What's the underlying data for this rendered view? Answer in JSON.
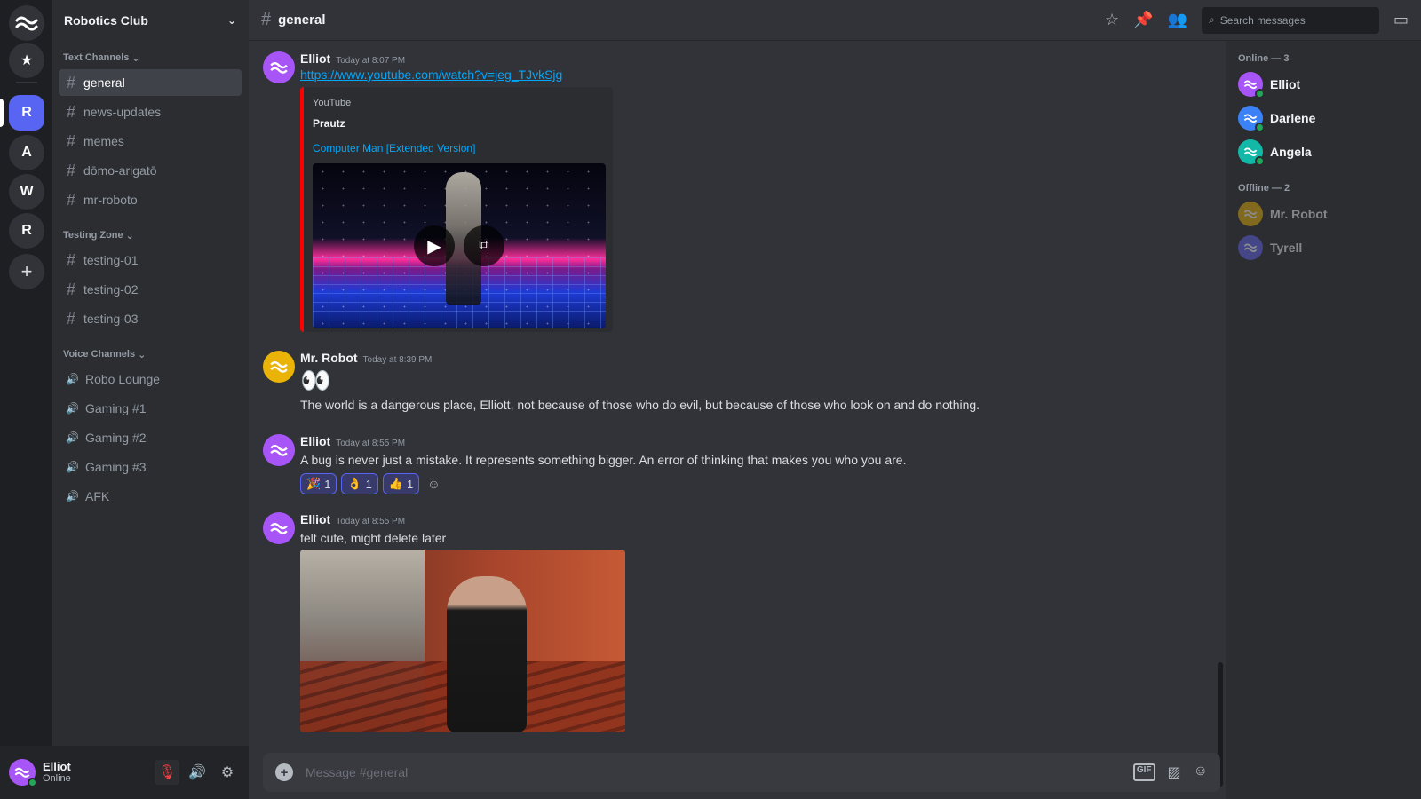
{
  "server_rail": {
    "servers": [
      {
        "initial": "R",
        "active": true
      },
      {
        "initial": "A",
        "active": false
      },
      {
        "initial": "W",
        "active": false
      },
      {
        "initial": "R",
        "active": false
      }
    ]
  },
  "guild": {
    "name": "Robotics Club"
  },
  "sidebar": {
    "categories": [
      {
        "label": "Text Channels",
        "channels": [
          "general",
          "news-updates",
          "memes",
          "dōmo-arigatō",
          "mr-roboto"
        ]
      },
      {
        "label": "Testing Zone",
        "channels": [
          "testing-01",
          "testing-02",
          "testing-03"
        ]
      },
      {
        "label": "Voice Channels",
        "channels": [
          "Robo Lounge",
          "Gaming #1",
          "Gaming #2",
          "Gaming #3",
          "AFK"
        ]
      }
    ]
  },
  "user_panel": {
    "name": "Elliot",
    "status": "Online"
  },
  "channel": {
    "name": "general",
    "search_placeholder": "Search messages"
  },
  "messages": [
    {
      "author": "Elliot",
      "time": "Today at 8:07 PM",
      "link": "https://www.youtube.com/watch?v=jeg_TJvkSjg",
      "embed": {
        "provider": "YouTube",
        "author": "Prautz",
        "title": "Computer Man [Extended Version]"
      }
    },
    {
      "author": "Mr. Robot",
      "time": "Today at 8:39 PM",
      "emoji": "👀",
      "text": "The world is a dangerous place, Elliott, not because of those who do evil, but because of those who look on and do nothing."
    },
    {
      "author": "Elliot",
      "time": "Today at 8:55 PM",
      "text": "A bug is never just a mistake. It represents something bigger. An error of thinking that makes you who you are.",
      "reactions": [
        {
          "emoji": "🎉",
          "count": "1"
        },
        {
          "emoji": "👌",
          "count": "1"
        },
        {
          "emoji": "👍",
          "count": "1"
        }
      ]
    },
    {
      "author": "Elliot",
      "time": "Today at 8:55 PM",
      "text": "felt cute, might delete later"
    }
  ],
  "composer": {
    "placeholder": "Message #general",
    "gif_label": "GIF"
  },
  "members": {
    "online_label": "Online — 3",
    "offline_label": "Offline — 2",
    "online": [
      {
        "name": "Elliot",
        "color": "#a855f7"
      },
      {
        "name": "Darlene",
        "color": "#3b82f6"
      },
      {
        "name": "Angela",
        "color": "#14b8a6"
      }
    ],
    "offline": [
      {
        "name": "Mr. Robot",
        "color": "#eab308"
      },
      {
        "name": "Tyrell",
        "color": "#6366f1"
      }
    ]
  },
  "colors": {
    "accent": "#5865f2",
    "online": "#23a55a",
    "link": "#00a8fc",
    "muted_mic": "#f23f43"
  }
}
